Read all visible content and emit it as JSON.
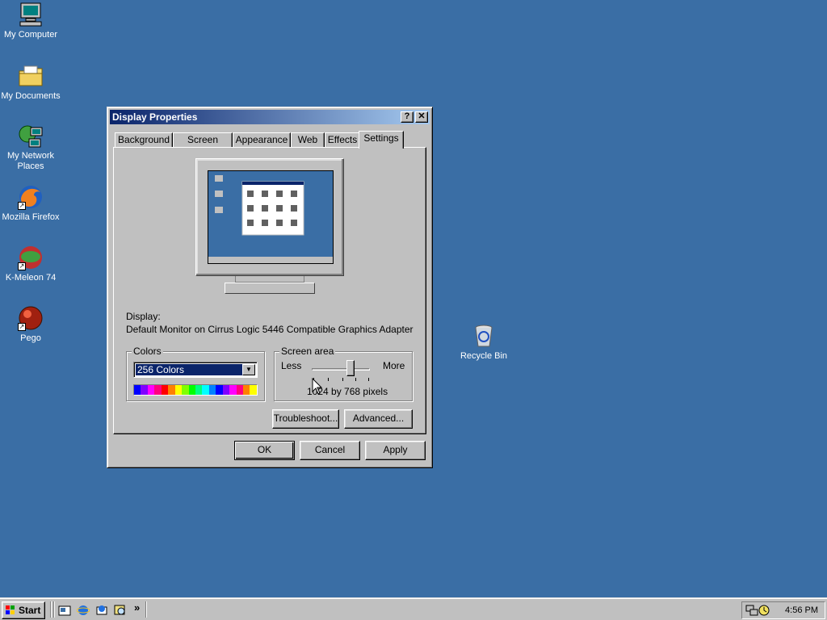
{
  "desktop": {
    "icons": [
      {
        "label": "My Computer"
      },
      {
        "label": "My Documents"
      },
      {
        "label": "My Network Places"
      },
      {
        "label": "Mozilla Firefox"
      },
      {
        "label": "K-Meleon 74"
      },
      {
        "label": "Pego"
      },
      {
        "label": "Recycle Bin"
      }
    ]
  },
  "window": {
    "title": "Display Properties",
    "help_button": "?",
    "close_button": "✕",
    "tabs": [
      {
        "label": "Background"
      },
      {
        "label": "Screen Saver"
      },
      {
        "label": "Appearance"
      },
      {
        "label": "Web"
      },
      {
        "label": "Effects"
      },
      {
        "label": "Settings",
        "active": true
      }
    ],
    "display_label": "Display:",
    "display_value": "Default Monitor on Cirrus Logic 5446 Compatible Graphics Adapter",
    "colors": {
      "group_label": "Colors",
      "selected": "256 Colors"
    },
    "screen_area": {
      "group_label": "Screen area",
      "less_label": "Less",
      "more_label": "More",
      "resolution_text": "1024 by 768 pixels",
      "slider_position": 0.66
    },
    "buttons": {
      "troubleshoot": "Troubleshoot...",
      "advanced": "Advanced...",
      "ok": "OK",
      "cancel": "Cancel",
      "apply": "Apply"
    }
  },
  "taskbar": {
    "start_label": "Start",
    "quick_launch_more": "»",
    "clock": "4:56 PM"
  },
  "colors": {
    "desktop": "#3a6ea5",
    "title_start": "#0a246a",
    "title_end": "#a6caf0",
    "face": "#c0c0c0"
  }
}
